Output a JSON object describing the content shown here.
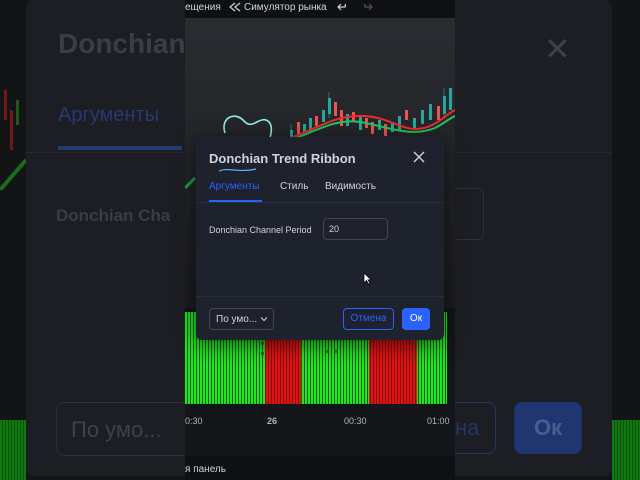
{
  "background": {
    "title": "Donchian",
    "tab": "Аргументы",
    "field_label": "Donchian Cha",
    "preset": "По умо...",
    "cancel_fragment": "на",
    "ok": "Ок"
  },
  "toolbar": {
    "item_left": "ещения",
    "market_sim_label": "Симулятор рынка",
    "market_sim_icon": "rewind-icon",
    "undo_icon": "undo-icon",
    "redo_icon": "redo-icon"
  },
  "time_axis": {
    "labels": [
      "0:30",
      "26",
      "00:30",
      "01:00"
    ]
  },
  "bottom_bar": {
    "label": "я панель"
  },
  "dialog": {
    "title": "Donchian Trend Ribbon",
    "close_icon": "close-icon",
    "tabs": [
      {
        "label": "Аргументы",
        "active": true
      },
      {
        "label": "Стиль",
        "active": false
      },
      {
        "label": "Видимость",
        "active": false
      }
    ],
    "field": {
      "label": "Donchian Channel Period",
      "value": "20"
    },
    "preset": {
      "label": "По умо...",
      "icon": "chevron-down-icon"
    },
    "cancel_label": "Отмена",
    "ok_label": "Ок"
  },
  "colors": {
    "accent": "#2962ff",
    "dialog_bg": "#1e222d",
    "ribbon_green": "#00ff00",
    "ribbon_red": "#ff0000"
  }
}
